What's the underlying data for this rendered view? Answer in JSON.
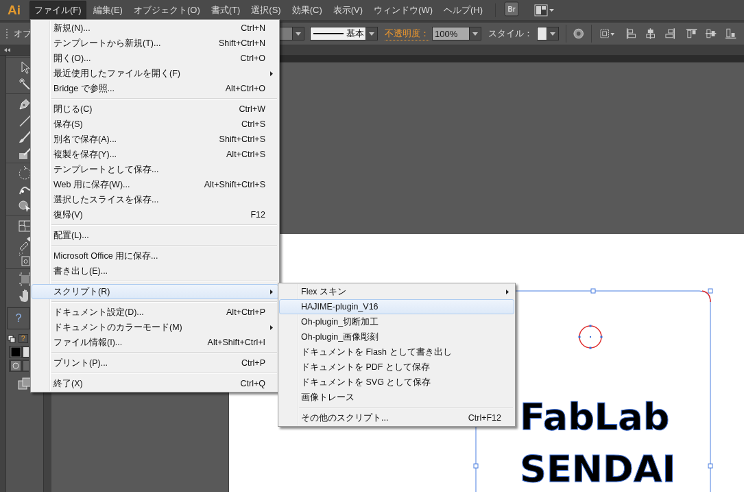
{
  "app_logo": "Ai",
  "menu_bar": [
    {
      "label": "ファイル(F)",
      "selected": true
    },
    {
      "label": "編集(E)",
      "selected": false
    },
    {
      "label": "オブジェクト(O)",
      "selected": false
    },
    {
      "label": "書式(T)",
      "selected": false
    },
    {
      "label": "選択(S)",
      "selected": false
    },
    {
      "label": "効果(C)",
      "selected": false
    },
    {
      "label": "表示(V)",
      "selected": false
    },
    {
      "label": "ウィンドウ(W)",
      "selected": false
    },
    {
      "label": "ヘルプ(H)",
      "selected": false
    }
  ],
  "bridge_button": "Br",
  "control_bar": {
    "object_label": "オブ",
    "stroke_style": "基本",
    "opacity_label": "不透明度：",
    "opacity_value": "100%",
    "style_label": "スタイル："
  },
  "toolbar": {
    "help_marks": [
      "?",
      "?"
    ]
  },
  "file_menu": {
    "items": [
      {
        "kind": "item",
        "label": "新規(N)...",
        "shortcut": "Ctrl+N",
        "submenu": false,
        "selected": false
      },
      {
        "kind": "item",
        "label": "テンプレートから新規(T)...",
        "shortcut": "Shift+Ctrl+N",
        "submenu": false,
        "selected": false
      },
      {
        "kind": "item",
        "label": "開く(O)...",
        "shortcut": "Ctrl+O",
        "submenu": false,
        "selected": false
      },
      {
        "kind": "item",
        "label": "最近使用したファイルを開く(F)",
        "submenu": true,
        "selected": false
      },
      {
        "kind": "item",
        "label": "Bridge で参照...",
        "shortcut": "Alt+Ctrl+O",
        "submenu": false,
        "selected": false
      },
      {
        "kind": "separator"
      },
      {
        "kind": "item",
        "label": "閉じる(C)",
        "shortcut": "Ctrl+W",
        "submenu": false,
        "selected": false
      },
      {
        "kind": "item",
        "label": "保存(S)",
        "shortcut": "Ctrl+S",
        "submenu": false,
        "selected": false
      },
      {
        "kind": "item",
        "label": "別名で保存(A)...",
        "shortcut": "Shift+Ctrl+S",
        "submenu": false,
        "selected": false
      },
      {
        "kind": "item",
        "label": "複製を保存(Y)...",
        "shortcut": "Alt+Ctrl+S",
        "submenu": false,
        "selected": false
      },
      {
        "kind": "item",
        "label": "テンプレートとして保存...",
        "submenu": false,
        "selected": false
      },
      {
        "kind": "item",
        "label": "Web 用に保存(W)...",
        "shortcut": "Alt+Shift+Ctrl+S",
        "submenu": false,
        "selected": false
      },
      {
        "kind": "item",
        "label": "選択したスライスを保存...",
        "submenu": false,
        "selected": false
      },
      {
        "kind": "item",
        "label": "復帰(V)",
        "shortcut": "F12",
        "submenu": false,
        "selected": false
      },
      {
        "kind": "separator"
      },
      {
        "kind": "item",
        "label": "配置(L)...",
        "submenu": false,
        "selected": false
      },
      {
        "kind": "separator"
      },
      {
        "kind": "item",
        "label": "Microsoft Office 用に保存...",
        "submenu": false,
        "selected": false
      },
      {
        "kind": "item",
        "label": "書き出し(E)...",
        "submenu": false,
        "selected": false
      },
      {
        "kind": "separator"
      },
      {
        "kind": "item",
        "label": "スクリプト(R)",
        "submenu": true,
        "selected": true
      },
      {
        "kind": "separator"
      },
      {
        "kind": "item",
        "label": "ドキュメント設定(D)...",
        "shortcut": "Alt+Ctrl+P",
        "submenu": false,
        "selected": false
      },
      {
        "kind": "item",
        "label": "ドキュメントのカラーモード(M)",
        "submenu": true,
        "selected": false
      },
      {
        "kind": "item",
        "label": "ファイル情報(I)...",
        "shortcut": "Alt+Shift+Ctrl+I",
        "submenu": false,
        "selected": false
      },
      {
        "kind": "separator"
      },
      {
        "kind": "item",
        "label": "プリント(P)...",
        "shortcut": "Ctrl+P",
        "submenu": false,
        "selected": false
      },
      {
        "kind": "separator"
      },
      {
        "kind": "item",
        "label": "終了(X)",
        "shortcut": "Ctrl+Q",
        "submenu": false,
        "selected": false
      }
    ]
  },
  "script_submenu": {
    "items": [
      {
        "kind": "item",
        "label": "Flex スキン",
        "submenu": true,
        "selected": false
      },
      {
        "kind": "item",
        "label": "HAJIME-plugin_V16",
        "submenu": false,
        "selected": true
      },
      {
        "kind": "item",
        "label": "Oh-plugin_切断加工",
        "submenu": false,
        "selected": false
      },
      {
        "kind": "item",
        "label": "Oh-plugin_画像彫刻",
        "submenu": false,
        "selected": false
      },
      {
        "kind": "item",
        "label": "ドキュメントを Flash として書き出し",
        "submenu": false,
        "selected": false
      },
      {
        "kind": "item",
        "label": "ドキュメントを PDF として保存",
        "submenu": false,
        "selected": false
      },
      {
        "kind": "item",
        "label": "ドキュメントを SVG として保存",
        "submenu": false,
        "selected": false
      },
      {
        "kind": "item",
        "label": "画像トレース",
        "submenu": false,
        "selected": false
      },
      {
        "kind": "separator"
      },
      {
        "kind": "item",
        "label": "その他のスクリプト...",
        "shortcut": "Ctrl+F12",
        "submenu": false,
        "selected": false
      }
    ]
  },
  "artwork": {
    "lines": [
      "FabLab",
      "SENDAI"
    ]
  }
}
